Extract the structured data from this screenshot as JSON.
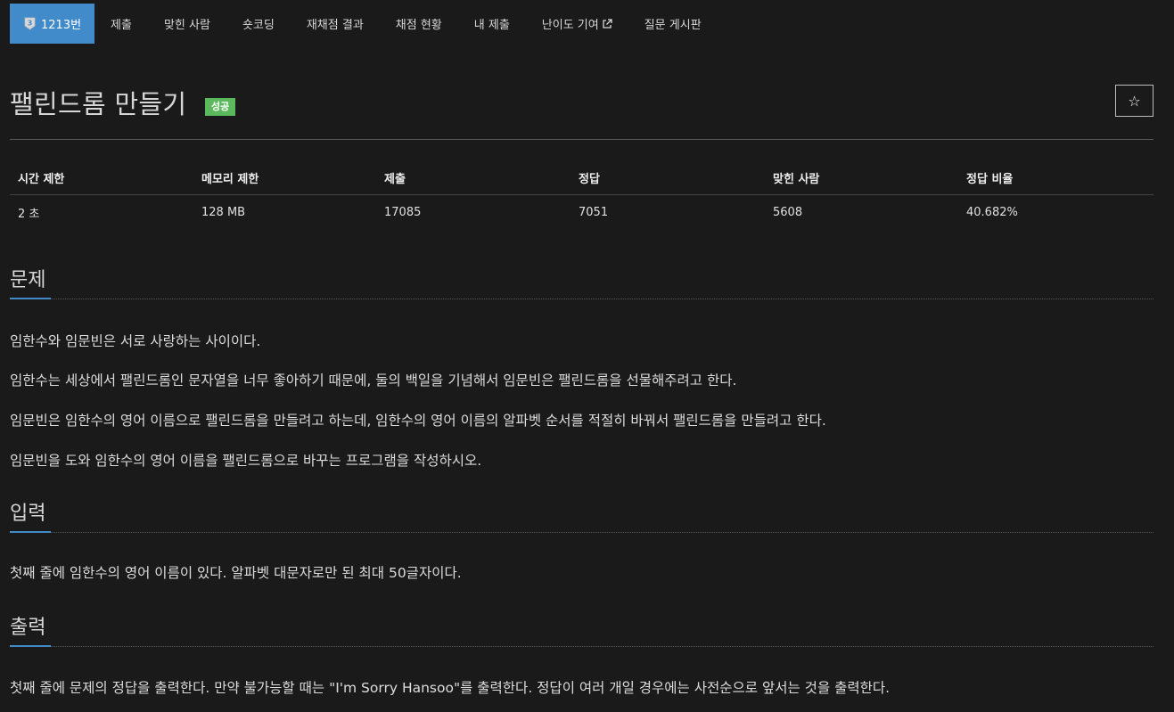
{
  "nav": {
    "problem_number": "1213번",
    "tier_level": "3",
    "items": [
      "제출",
      "맞힌 사람",
      "숏코딩",
      "재채점 결과",
      "채점 현황",
      "내 제출",
      "난이도 기여",
      "질문 게시판"
    ]
  },
  "problem": {
    "title": "팰린드롬 만들기",
    "result_badge": "성공",
    "star_icon": "☆"
  },
  "info_table": {
    "headers": [
      "시간 제한",
      "메모리 제한",
      "제출",
      "정답",
      "맞힌 사람",
      "정답 비율"
    ],
    "values": [
      "2 초",
      "128 MB",
      "17085",
      "7051",
      "5608",
      "40.682%"
    ]
  },
  "sections": {
    "description": {
      "title": "문제",
      "paragraphs": [
        "임한수와 임문빈은 서로 사랑하는 사이이다.",
        "임한수는 세상에서 팰린드롬인 문자열을 너무 좋아하기 때문에, 둘의 백일을 기념해서 임문빈은 팰린드롬을 선물해주려고 한다.",
        "임문빈은 임한수의 영어 이름으로 팰린드롬을 만들려고 하는데, 임한수의 영어 이름의 알파벳 순서를 적절히 바꿔서 팰린드롬을 만들려고 한다.",
        "임문빈을 도와 임한수의 영어 이름을 팰린드롬으로 바꾸는 프로그램을 작성하시오."
      ]
    },
    "input": {
      "title": "입력",
      "paragraphs": [
        "첫째 줄에 임한수의 영어 이름이 있다. 알파벳 대문자로만 된 최대 50글자이다."
      ]
    },
    "output": {
      "title": "출력",
      "paragraphs": [
        "첫째 줄에 문제의 정답을 출력한다. 만약 불가능할 때는 \"I'm Sorry Hansoo\"를 출력한다. 정답이 여러 개일 경우에는 사전순으로 앞서는 것을 출력한다."
      ]
    }
  },
  "colors": {
    "accent": "#428bca",
    "success": "#5cb85c",
    "background": "#1a1a1a"
  }
}
